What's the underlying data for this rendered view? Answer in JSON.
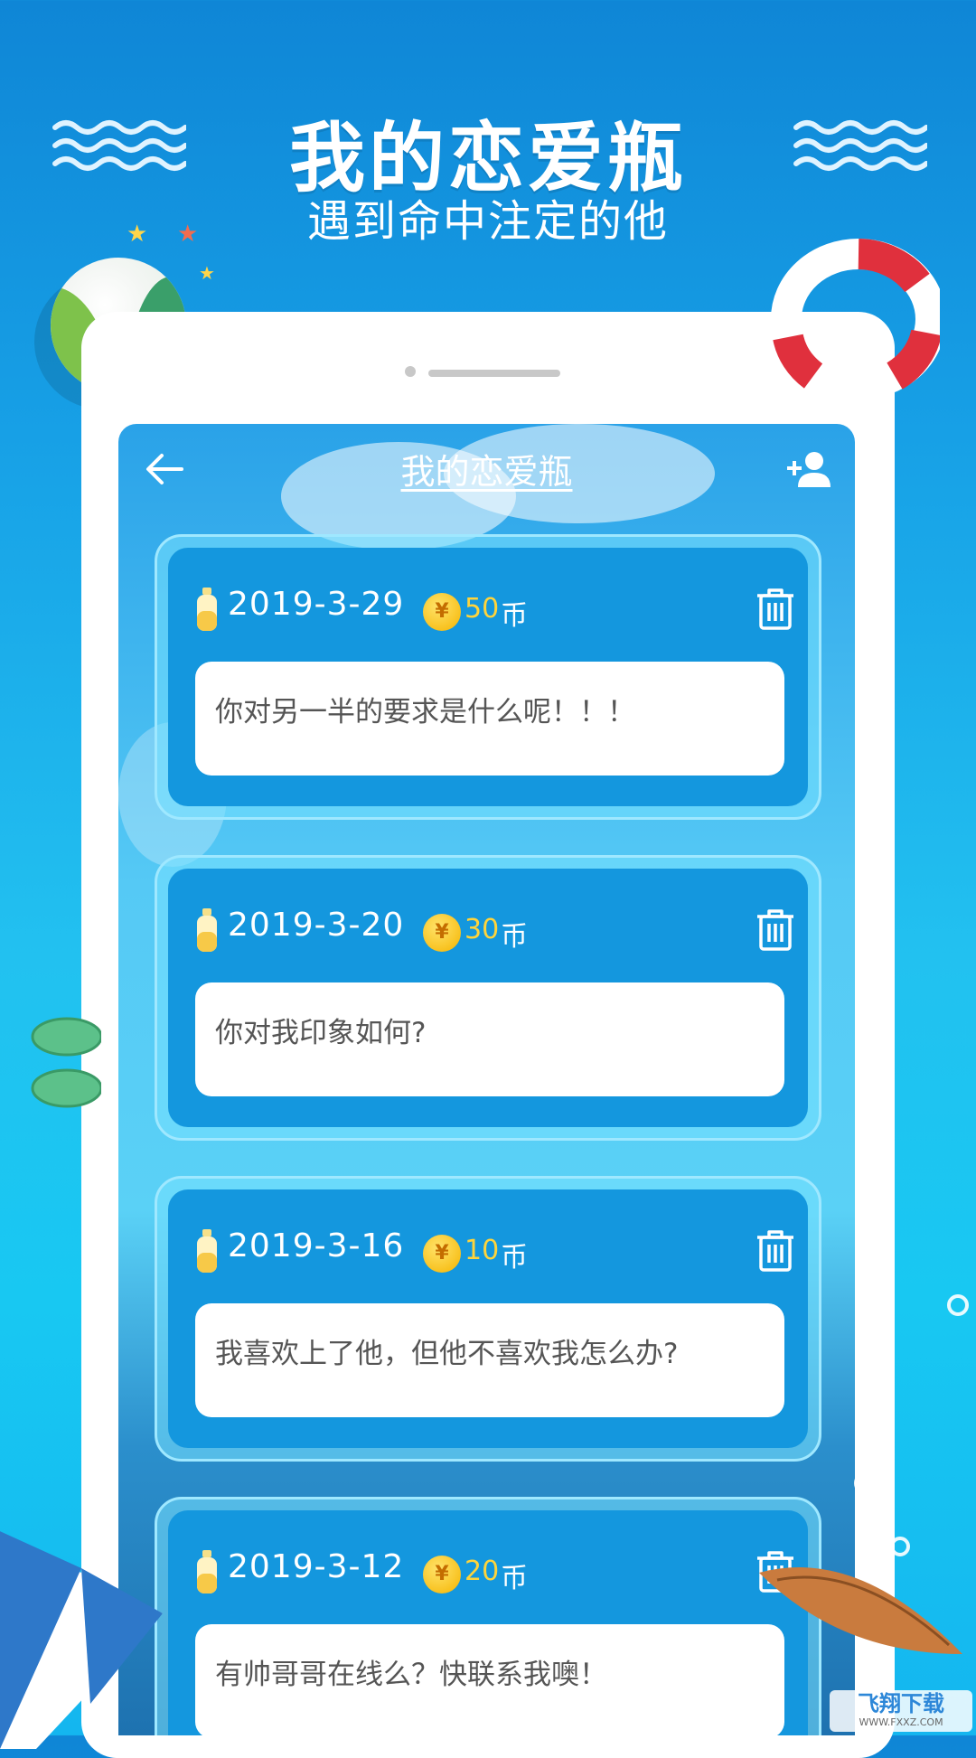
{
  "promo": {
    "title": "我的恋爱瓶",
    "subtitle": "遇到命中注定的他"
  },
  "app": {
    "header_title": "我的恋爱瓶"
  },
  "cards": [
    {
      "date": "2019-3-29",
      "coins": "50",
      "unit": "币",
      "question": "你对另一半的要求是什么呢！！！"
    },
    {
      "date": "2019-3-20",
      "coins": "30",
      "unit": "币",
      "question": "你对我印象如何?"
    },
    {
      "date": "2019-3-16",
      "coins": "10",
      "unit": "币",
      "question": "我喜欢上了他，但他不喜欢我怎么办?"
    },
    {
      "date": "2019-3-12",
      "coins": "20",
      "unit": "币",
      "question": "有帅哥哥在线么？快联系我噢！"
    }
  ],
  "coin_symbol": "¥",
  "watermark": {
    "brand": "飞翔下载",
    "url": "WWW.FXXZ.COM"
  },
  "colors": {
    "accent": "#1497de",
    "coin_text": "#ffd43b",
    "background_top": "#0f86d6",
    "background_bottom": "#14b6ef"
  },
  "icons": [
    "back-arrow-icon",
    "add-user-icon",
    "bottle-icon",
    "coin-icon",
    "trash-icon"
  ]
}
